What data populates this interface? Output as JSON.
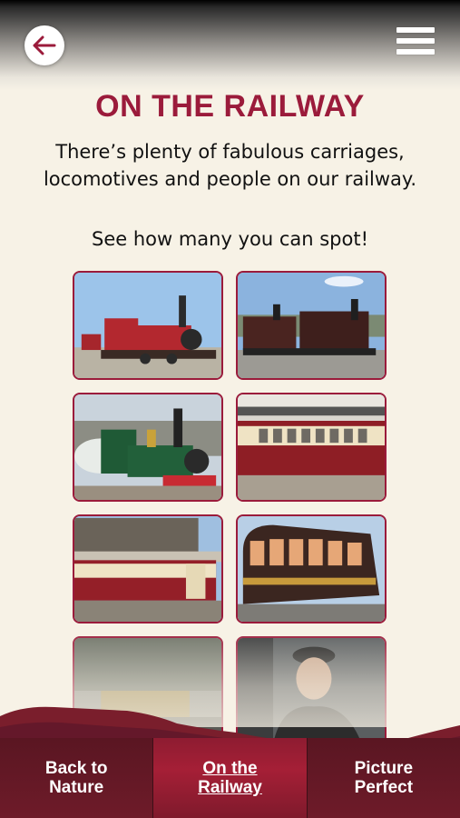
{
  "header": {
    "back_icon": "arrow-left-icon",
    "menu_icon": "hamburger-menu-icon"
  },
  "title": "ON THE RAILWAY",
  "intro": "There’s plenty of fabulous carriages, locomotives and people on our railway.",
  "cta": "See how many you can spot!",
  "gallery": {
    "items": [
      "red-locomotive-photo",
      "double-fairlie-locomotive-photo",
      "green-locomotive-photo",
      "red-carriage-at-station-photo",
      "red-carriages-photo",
      "observation-carriage-photo",
      "yellow-carriage-photo",
      "train-driver-photo"
    ]
  },
  "tabs": [
    {
      "label": "Back to\nNature",
      "active": false
    },
    {
      "label": "On the\nRailway",
      "active": true
    },
    {
      "label": "Picture\nPerfect",
      "active": false
    }
  ],
  "colors": {
    "accent": "#9b1b3b",
    "tabbar": "#6e1b29",
    "background": "#f7f2e6"
  }
}
